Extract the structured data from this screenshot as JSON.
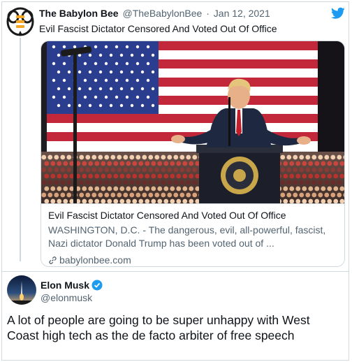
{
  "quoted_tweet": {
    "author_name": "The Babylon Bee",
    "handle": "@TheBabylonBee",
    "separator": "·",
    "date": "Jan 12, 2021",
    "text": "Evil Fascist Dictator Censored And Voted Out Of Office",
    "card": {
      "title": "Evil Fascist Dictator Censored And Voted Out Of Office",
      "description": "WASHINGTON, D.C. - The dangerous, evil, all-powerful, fascist, Nazi dictator Donald Trump has been voted out of ...",
      "domain": "babylonbee.com",
      "icon": "link-icon"
    }
  },
  "main_tweet": {
    "author_name": "Elon Musk",
    "handle": "@elonmusk",
    "verified_icon": "verified-icon",
    "text": "A lot of people are going to be super unhappy with West Coast high tech as the de facto arbiter of free speech"
  },
  "icons": {
    "platform": "twitter-bird-icon"
  },
  "colors": {
    "twitter_blue": "#1d9bf0",
    "bee_yellow": "#f5a623",
    "secondary_text": "#536471",
    "border": "#cfd9de"
  }
}
